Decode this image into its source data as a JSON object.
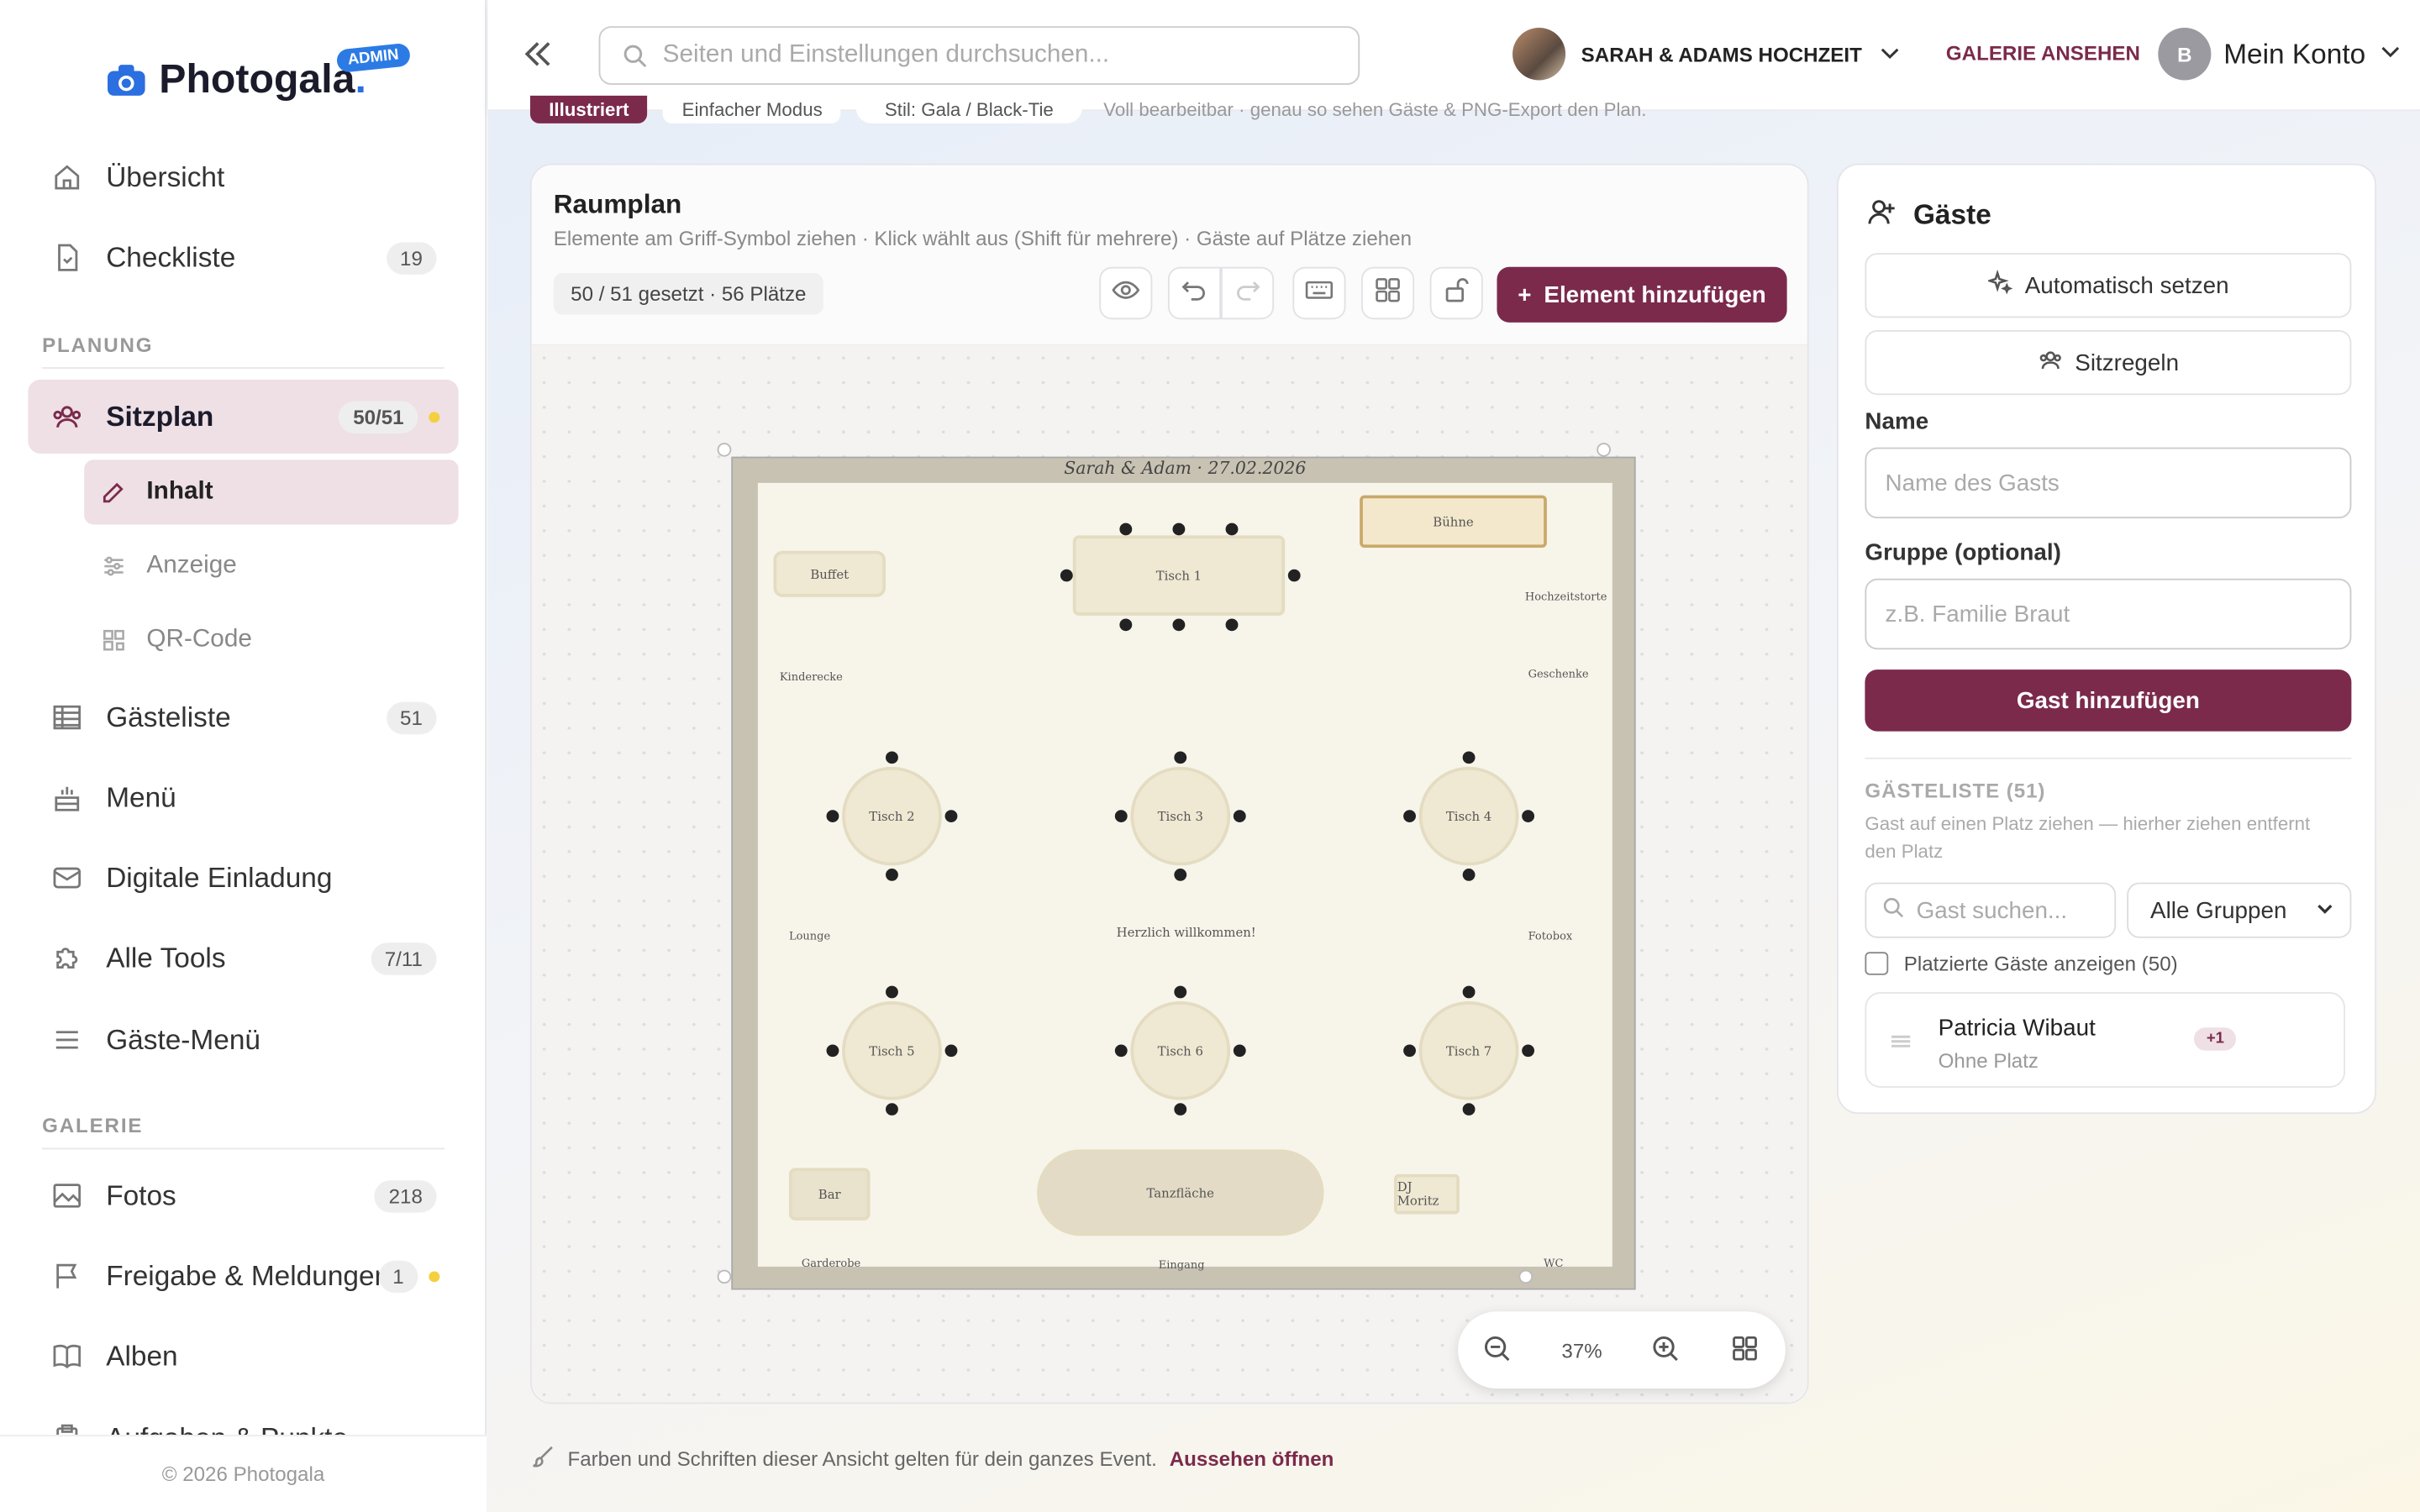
{
  "brand": {
    "name": "Photogala",
    "dot": ".",
    "admin": "ADMIN"
  },
  "sidebar": {
    "items": [
      {
        "label": "Übersicht"
      },
      {
        "label": "Checkliste",
        "badge": "19"
      },
      {
        "label": "Sitzplan",
        "badge": "50/51"
      },
      {
        "label": "Gästeliste",
        "badge": "51"
      },
      {
        "label": "Menü"
      },
      {
        "label": "Digitale Einladung"
      },
      {
        "label": "Alle Tools",
        "badge": "7/11"
      },
      {
        "label": "Gäste-Menü"
      },
      {
        "label": "Fotos",
        "badge": "218"
      },
      {
        "label": "Freigabe & Meldungen",
        "badge": "1"
      },
      {
        "label": "Alben"
      },
      {
        "label": "Aufgaben & Punkte"
      }
    ],
    "sub": [
      "Inhalt",
      "Anzeige",
      "QR-Code"
    ],
    "sections": {
      "planung": "PLANUNG",
      "galerie": "GALERIE"
    },
    "footer": "© 2026 Photogala"
  },
  "topbar": {
    "search_placeholder": "Seiten und Einstellungen durchsuchen...",
    "event": "SARAH & ADAMS HOCHZEIT",
    "gallery": "GALERIE ANSEHEN",
    "account": "Mein Konto",
    "avatar_letter": "B"
  },
  "tabs": {
    "t1": "Illustriert",
    "t2": "Einfacher Modus",
    "t3": "Stil: Gala / Black-Tie",
    "t4": "Voll bearbeitbar · genau so sehen Gäste & PNG-Export den Plan."
  },
  "panel": {
    "title": "Raumplan",
    "subtitle": "Elemente am Griff-Symbol ziehen · Klick wählt aus (Shift für mehrere) · Gäste auf Plätze ziehen",
    "count": "50 / 51 gesetzt · 56 Plätze",
    "add": "Element hinzufügen",
    "zoom": "37%"
  },
  "room": {
    "title": "Sarah & Adam · 27.02.2026",
    "labels": {
      "buffet": "Buffet",
      "buehne": "Bühne",
      "torte": "Hochzeitstorte",
      "kinder": "Kinderecke",
      "geschenke": "Geschenke",
      "lounge": "Lounge",
      "fotobox": "Fotobox",
      "welcome": "Herzlich willkommen!",
      "bar": "Bar",
      "dj": "DJ Moritz",
      "tanz": "Tanzfläche",
      "garderobe": "Garderobe",
      "eingang": "Eingang",
      "wc": "WC"
    },
    "tables": [
      "Tisch 1",
      "Tisch 2",
      "Tisch 3",
      "Tisch 4",
      "Tisch 5",
      "Tisch 6",
      "Tisch 7"
    ]
  },
  "guests": {
    "title": "Gäste",
    "auto": "Automatisch setzen",
    "rules": "Sitzregeln",
    "name_label": "Name",
    "name_placeholder": "Name des Gasts",
    "group_label": "Gruppe (optional)",
    "group_placeholder": "z.B. Familie Braut",
    "add": "Gast hinzufügen",
    "list_title": "GÄSTELISTE (51)",
    "hint": "Gast auf einen Platz ziehen — hierher ziehen entfernt den Platz",
    "search_placeholder": "Gast suchen...",
    "group_select": "Alle Gruppen",
    "show_placed": "Platzierte Gäste anzeigen (50)",
    "card": {
      "name": "Patricia Wibaut",
      "status": "Ohne Platz",
      "plus": "+1"
    }
  },
  "note": {
    "text": "Farben und Schriften dieser Ansicht gelten für dein ganzes Event.",
    "link": "Aussehen öffnen"
  }
}
